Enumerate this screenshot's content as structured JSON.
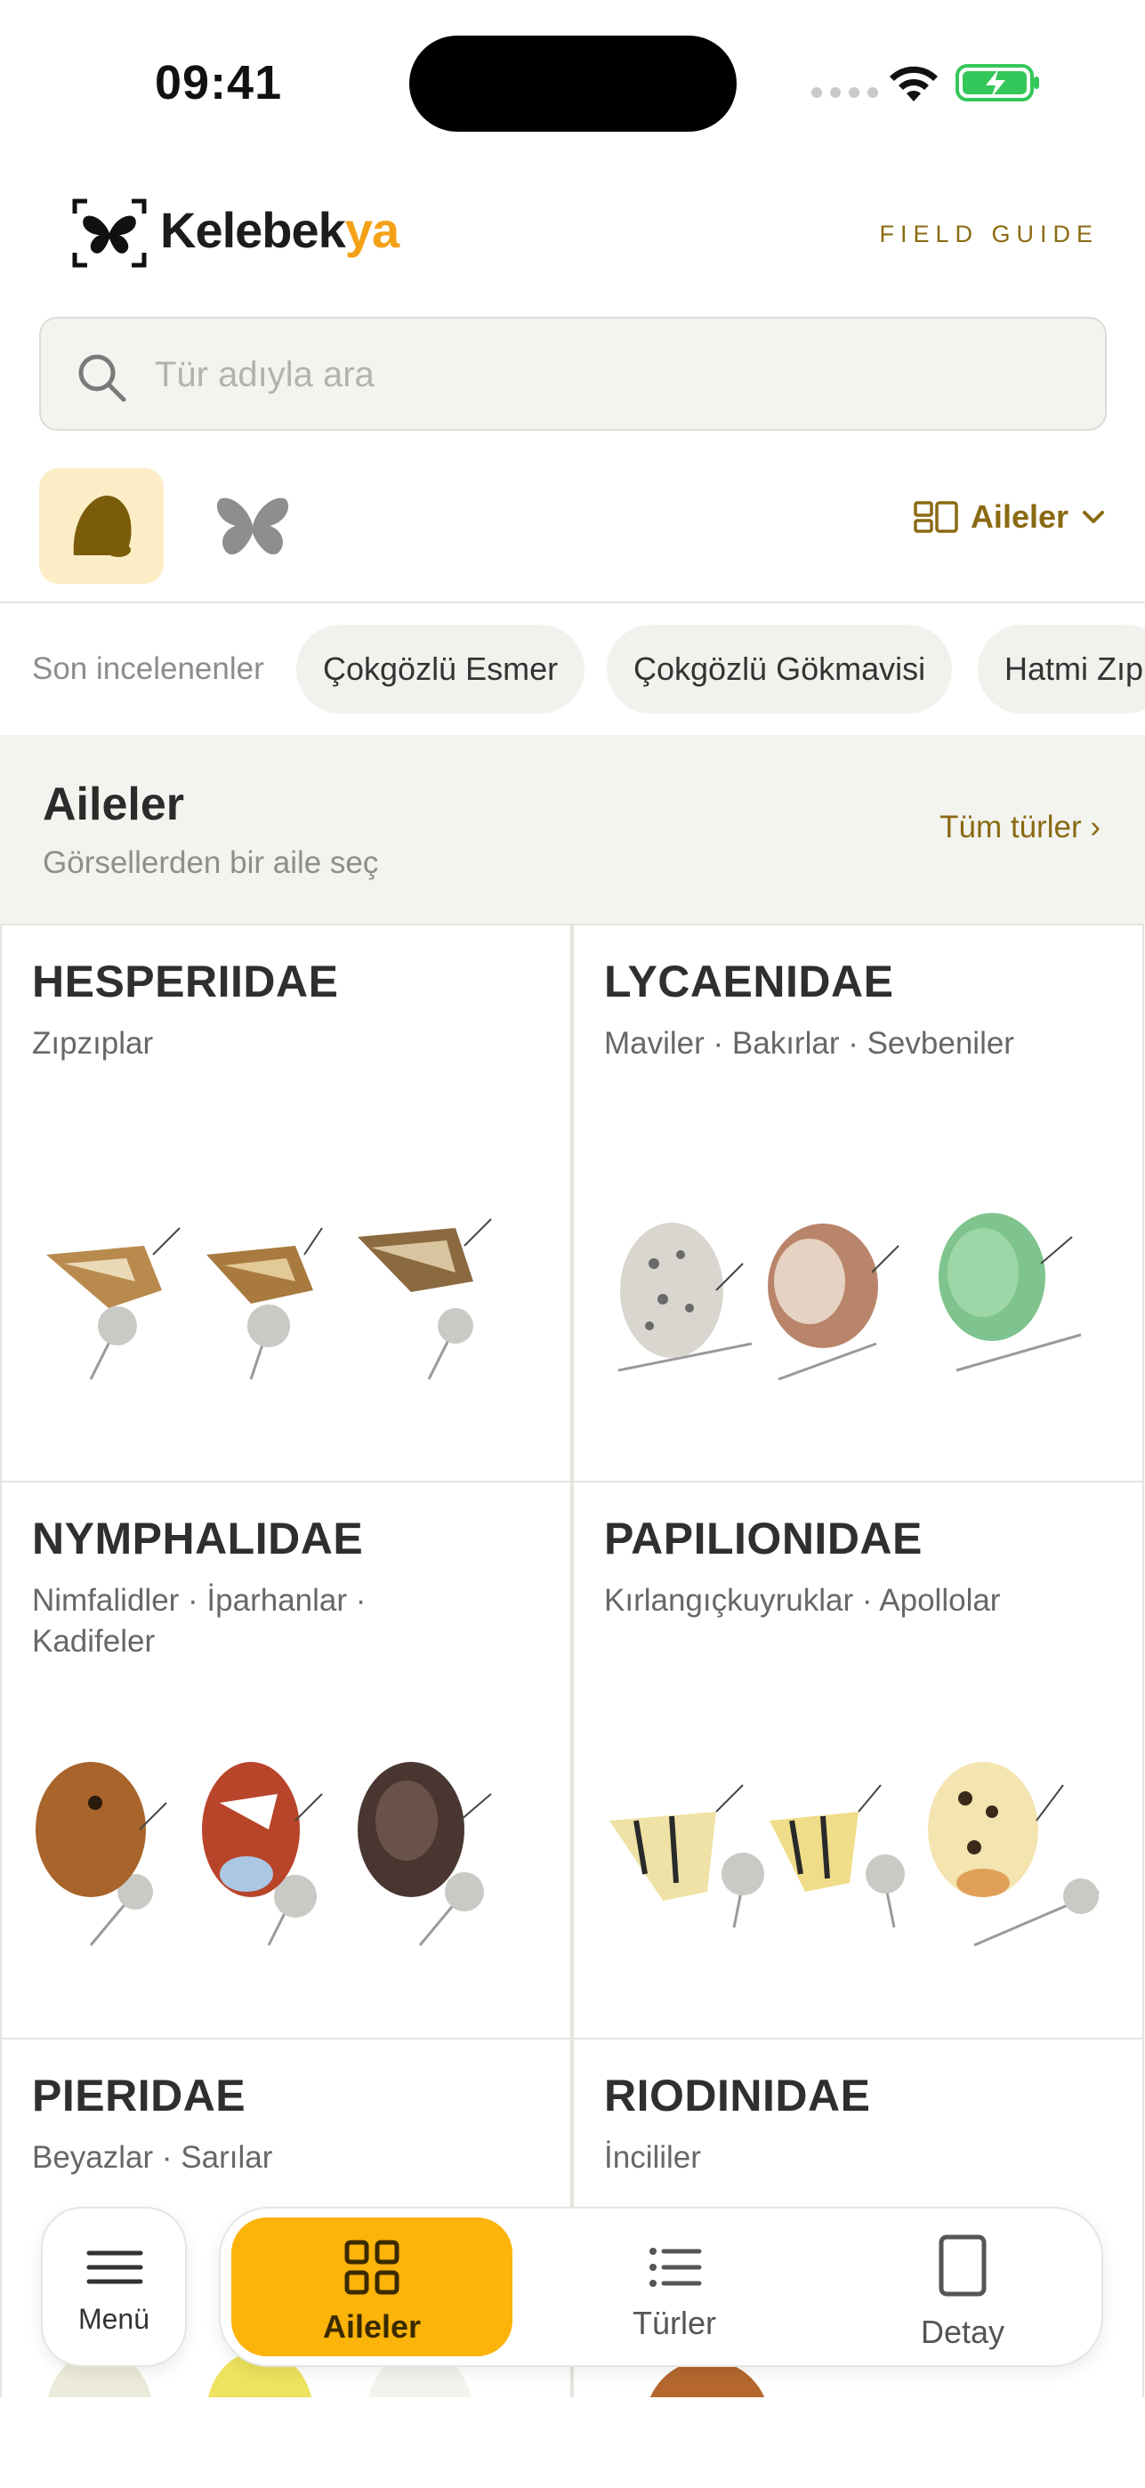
{
  "status_bar": {
    "time": "09:41"
  },
  "header": {
    "logo_text_main": "Kelebek",
    "logo_text_accent": "ya",
    "field_guide": "FIELD GUIDE"
  },
  "search": {
    "placeholder": "Tür adıyla ara",
    "value": ""
  },
  "view_toggle": {
    "selected": "egg",
    "options": [
      "egg",
      "butterfly"
    ]
  },
  "group_select": {
    "label": "Aileler"
  },
  "recent": {
    "label": "Son incelenenler",
    "chips": [
      "Çokgözlü Esmer",
      "Çokgözlü Gökmavisi",
      "Hatmi Zıp"
    ]
  },
  "section": {
    "title": "Aileler",
    "subtitle": "Görsellerden bir aile seç",
    "all_link": "Tüm türler ›"
  },
  "families": [
    {
      "name": "HESPERIIDAE",
      "common": "Zıpzıplar"
    },
    {
      "name": "LYCAENIDAE",
      "common": "Maviler · Bakırlar · Sevbeniler"
    },
    {
      "name": "NYMPHALIDAE",
      "common": "Nimfalidler · İparhanlar · Kadifeler"
    },
    {
      "name": "PAPILIONIDAE",
      "common": "Kırlangıçkuyruklar · Apollolar"
    },
    {
      "name": "PIERIDAE",
      "common": "Beyazlar · Sarılar"
    },
    {
      "name": "RIODINIDAE",
      "common": "İncililer"
    }
  ],
  "bottom_nav": {
    "menu": "Menü",
    "tabs": [
      {
        "label": "Aileler",
        "icon": "grid-icon",
        "active": true
      },
      {
        "label": "Türler",
        "icon": "list-icon",
        "active": false
      },
      {
        "label": "Detay",
        "icon": "page-icon",
        "active": false
      }
    ]
  },
  "colors": {
    "accent": "#f5a118",
    "gold_text": "#8a6a12",
    "active_tab": "#fcb30a"
  }
}
